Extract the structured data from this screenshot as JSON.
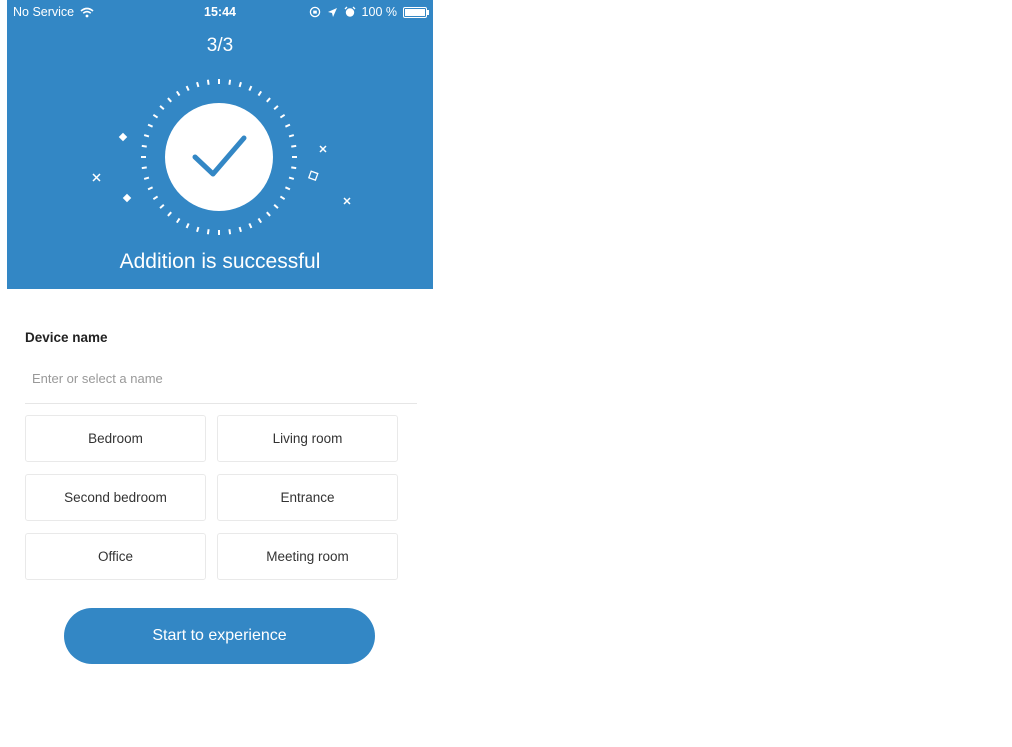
{
  "status_bar": {
    "carrier": "No Service",
    "time": "15:44",
    "battery_percent": "100 %",
    "icons": [
      "wifi-icon",
      "orientation-lock-icon",
      "location-arrow-icon",
      "alarm-icon",
      "battery-icon"
    ]
  },
  "header": {
    "step": "3/3",
    "success_text": "Addition is successful",
    "background_color": "#3387c5"
  },
  "form": {
    "label": "Device name",
    "placeholder": "Enter or select a name",
    "options": [
      "Bedroom",
      "Living room",
      "Second bedroom",
      "Entrance",
      "Office",
      "Meeting room"
    ]
  },
  "cta": {
    "label": "Start to experience",
    "color": "#3387c5"
  }
}
